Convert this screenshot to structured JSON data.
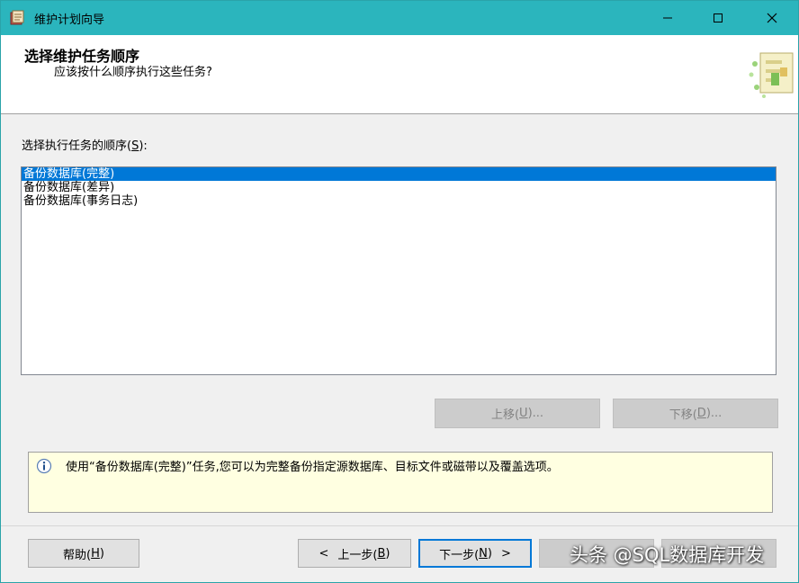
{
  "window": {
    "title": "维护计划向导",
    "titlebar_color": "#2bb5bd"
  },
  "header": {
    "title": "选择维护任务顺序",
    "subtitle": "应该按什么顺序执行这些任务?"
  },
  "order_section": {
    "label": "选择执行任务的顺序(",
    "label_mnemonic": "S",
    "label_suffix": "):"
  },
  "task_list": {
    "items": [
      {
        "label": "备份数据库(完整)",
        "selected": true
      },
      {
        "label": "备份数据库(差异)",
        "selected": false
      },
      {
        "label": "备份数据库(事务日志)",
        "selected": false
      }
    ],
    "selection_color": "#0078d7"
  },
  "move_buttons": {
    "up": {
      "prefix": "上移(",
      "mnemonic": "U",
      "suffix": ")..."
    },
    "down": {
      "prefix": "下移(",
      "mnemonic": "D",
      "suffix": ")..."
    }
  },
  "info": {
    "icon": "info-icon",
    "text": "使用“备份数据库(完整)”任务,您可以为完整备份指定源数据库、目标文件或磁带以及覆盖选项。"
  },
  "footer": {
    "help": {
      "prefix": "帮助(",
      "mnemonic": "H",
      "suffix": ")"
    },
    "prev": {
      "arrow": "<",
      "prefix": "上一步(",
      "mnemonic": "B",
      "suffix": ")"
    },
    "next": {
      "prefix": "下一步(",
      "mnemonic": "N",
      "suffix": ")",
      "arrow": ">"
    }
  },
  "watermark": "头条 @SQL数据库开发"
}
